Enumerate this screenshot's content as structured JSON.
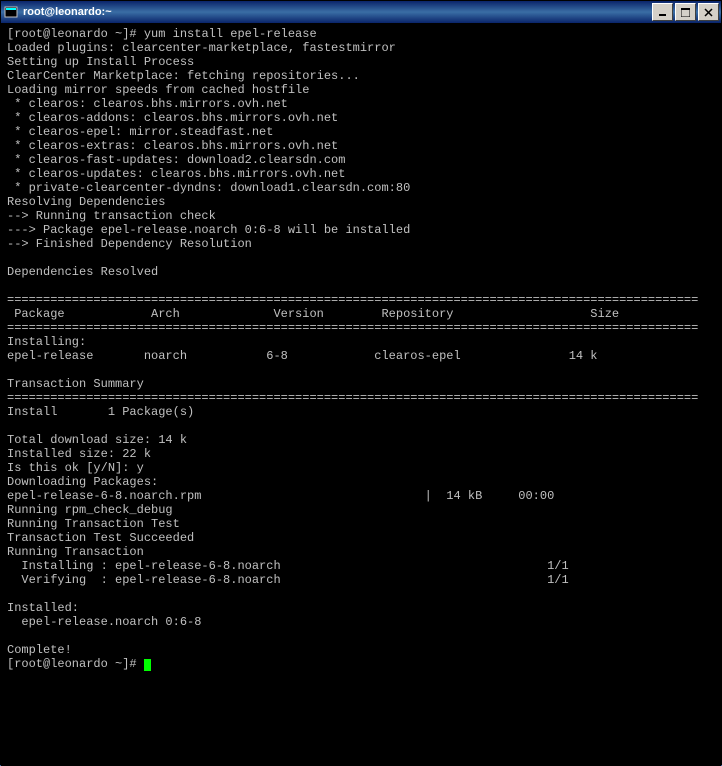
{
  "window": {
    "title": "root@leonardo:~"
  },
  "terminal": {
    "prompt": "[root@leonardo ~]# ",
    "command": "yum install epel-release",
    "output_lines": [
      "Loaded plugins: clearcenter-marketplace, fastestmirror",
      "Setting up Install Process",
      "ClearCenter Marketplace: fetching repositories...",
      "Loading mirror speeds from cached hostfile",
      " * clearos: clearos.bhs.mirrors.ovh.net",
      " * clearos-addons: clearos.bhs.mirrors.ovh.net",
      " * clearos-epel: mirror.steadfast.net",
      " * clearos-extras: clearos.bhs.mirrors.ovh.net",
      " * clearos-fast-updates: download2.clearsdn.com",
      " * clearos-updates: clearos.bhs.mirrors.ovh.net",
      " * private-clearcenter-dyndns: download1.clearsdn.com:80",
      "Resolving Dependencies",
      "--> Running transaction check",
      "---> Package epel-release.noarch 0:6-8 will be installed",
      "--> Finished Dependency Resolution",
      "",
      "Dependencies Resolved",
      ""
    ],
    "separator": "================================================================================================",
    "table_header": " Package            Arch             Version        Repository                   Size",
    "installing_label": "Installing:",
    "package_row": "epel-release       noarch           6-8            clearos-epel               14 k",
    "summary_label": "Transaction Summary",
    "install_count": "Install       1 Package(s)",
    "download_size": "Total download size: 14 k",
    "installed_size": "Installed size: 22 k",
    "confirm_prompt": "Is this ok [y/N]: ",
    "confirm_answer": "y",
    "downloading": "Downloading Packages:",
    "rpm_line": "epel-release-6-8.noarch.rpm                               |  14 kB     00:00",
    "rpm_check": "Running rpm_check_debug",
    "trans_test": "Running Transaction Test",
    "trans_test_ok": "Transaction Test Succeeded",
    "running_trans": "Running Transaction",
    "installing_pkg": "  Installing : epel-release-6-8.noarch                                     1/1",
    "verifying_pkg": "  Verifying  : epel-release-6-8.noarch                                     1/1",
    "installed_label": "Installed:",
    "installed_pkg": "  epel-release.noarch 0:6-8",
    "complete": "Complete!",
    "prompt2": "[root@leonardo ~]# "
  }
}
